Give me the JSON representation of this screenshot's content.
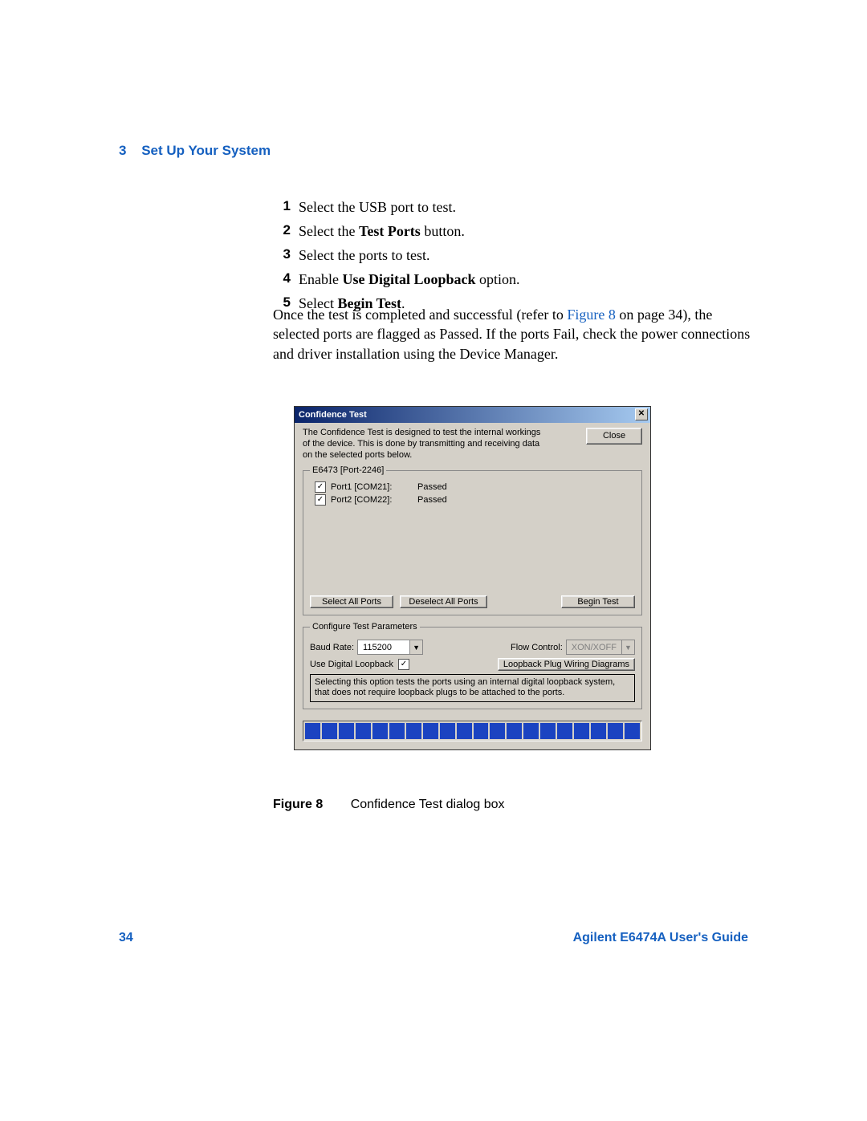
{
  "section": {
    "number": "3",
    "title": "Set Up Your System"
  },
  "steps": [
    {
      "n": "1",
      "pre": "Select the USB port to test."
    },
    {
      "n": "2",
      "pre": "Select the ",
      "bold": "Test Ports",
      "post": " button."
    },
    {
      "n": "3",
      "pre": "Select the ports to test."
    },
    {
      "n": "4",
      "pre": "Enable ",
      "bold": "Use Digital Loopback",
      "post": " option."
    },
    {
      "n": "5",
      "pre": "Select ",
      "bold": "Begin Test",
      "post": "."
    }
  ],
  "paragraph": {
    "pre": "Once the test is completed and successful (refer to ",
    "xref": "Figure 8",
    "post": " on page 34), the selected ports are flagged as Passed. If the ports Fail, check the power connections and driver installation using the Device Manager."
  },
  "dialog": {
    "title": "Confidence Test",
    "intro": "The Confidence Test is designed to test the internal workings of the device. This is done by transmitting and receiving data on the selected ports below.",
    "close_btn": "Close",
    "fieldset_ports_legend": "E6473 [Port-2246]",
    "ports": [
      {
        "label": "Port1 [COM21]:",
        "status": "Passed"
      },
      {
        "label": "Port2 [COM22]:",
        "status": "Passed"
      }
    ],
    "select_all": "Select All Ports",
    "deselect_all": "Deselect All Ports",
    "begin_test": "Begin Test",
    "fieldset_params_legend": "Configure Test Parameters",
    "baud_label": "Baud Rate:",
    "baud_value": "115200",
    "flow_label": "Flow Control:",
    "flow_value": "XON/XOFF",
    "loopback_label": "Use Digital Loopback",
    "wiring_btn": "Loopback Plug Wiring Diagrams",
    "info": "Selecting this option tests the ports using an internal digital loopback system, that does not require loopback plugs to be attached to the ports."
  },
  "caption": {
    "label": "Figure 8",
    "text": "Confidence Test dialog box"
  },
  "footer": {
    "page": "34",
    "guide": "Agilent E6474A User's Guide"
  }
}
